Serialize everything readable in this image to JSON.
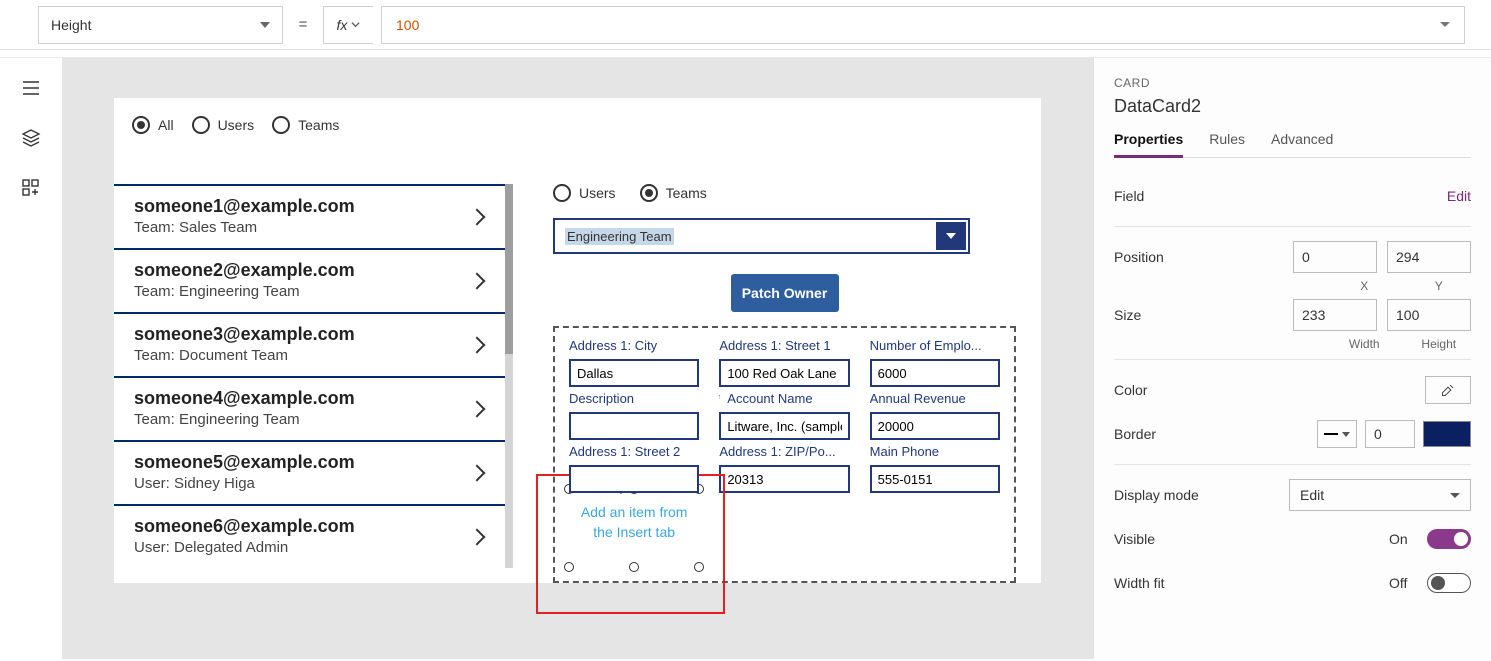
{
  "formula": {
    "property": "Height",
    "value": "100"
  },
  "canvas": {
    "top_radios": [
      {
        "label": "All",
        "selected": true
      },
      {
        "label": "Users",
        "selected": false
      },
      {
        "label": "Teams",
        "selected": false
      }
    ],
    "gallery": [
      {
        "email": "someone1@example.com",
        "sub": "Team: Sales Team"
      },
      {
        "email": "someone2@example.com",
        "sub": "Team: Engineering Team"
      },
      {
        "email": "someone3@example.com",
        "sub": "Team: Document Team"
      },
      {
        "email": "someone4@example.com",
        "sub": "Team: Engineering Team"
      },
      {
        "email": "someone5@example.com",
        "sub": "User: Sidney Higa"
      },
      {
        "email": "someone6@example.com",
        "sub": "User: Delegated Admin"
      }
    ],
    "sub_radios": [
      {
        "label": "Users",
        "selected": false
      },
      {
        "label": "Teams",
        "selected": true
      }
    ],
    "dropdown_value": "Engineering Team",
    "button": "Patch Owner",
    "form_cards": {
      "c0": {
        "label": "Address 1: City",
        "value": "Dallas"
      },
      "c1": {
        "label": "Address 1: Street 1",
        "value": "100 Red Oak Lane"
      },
      "c2": {
        "label": "Number of Emplo...",
        "value": "6000"
      },
      "c3": {
        "label": "Description",
        "value": ""
      },
      "c4": {
        "label": "Account Name",
        "value": "Litware, Inc. (sample)",
        "required": true
      },
      "c5": {
        "label": "Annual Revenue",
        "value": "20000"
      },
      "c6": {
        "label": "Address 1: Street 2",
        "value": ""
      },
      "c7": {
        "label": "Address 1: ZIP/Po...",
        "value": "20313"
      },
      "c8": {
        "label": "Main Phone",
        "value": "555-0151"
      }
    },
    "selected_card": {
      "tooltip": "Card",
      "placeholder_l1": "Add an item from",
      "placeholder_l2": "the Insert tab"
    }
  },
  "props": {
    "caption": "CARD",
    "title": "DataCard2",
    "tabs": [
      "Properties",
      "Rules",
      "Advanced"
    ],
    "field": {
      "label": "Field",
      "action": "Edit"
    },
    "position": {
      "label": "Position",
      "x": "0",
      "y": "294",
      "xl": "X",
      "yl": "Y"
    },
    "size": {
      "label": "Size",
      "w": "233",
      "h": "100",
      "wl": "Width",
      "hl": "Height"
    },
    "color": {
      "label": "Color"
    },
    "border": {
      "label": "Border",
      "value": "0"
    },
    "display_mode": {
      "label": "Display mode",
      "value": "Edit"
    },
    "visible": {
      "label": "Visible",
      "state": "On"
    },
    "width_fit": {
      "label": "Width fit",
      "state": "Off"
    }
  }
}
